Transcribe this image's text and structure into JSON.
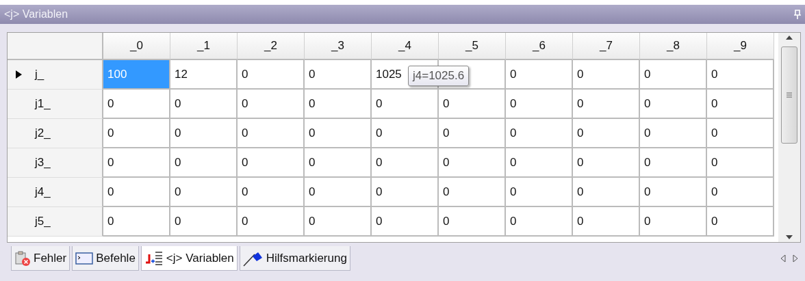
{
  "panel": {
    "title": "<j> Variablen"
  },
  "table": {
    "columns": [
      "_0",
      "_1",
      "_2",
      "_3",
      "_4",
      "_5",
      "_6",
      "_7",
      "_8",
      "_9"
    ],
    "rows": [
      {
        "name": "j_",
        "current": true,
        "cells": [
          {
            "value": "100",
            "selected": true
          },
          {
            "value": "12",
            "selected": false
          },
          {
            "value": "0",
            "selected": false
          },
          {
            "value": "0",
            "selected": false
          },
          {
            "value": "1025",
            "selected": false
          },
          {
            "selected": false
          },
          {
            "value": "0",
            "selected": false
          },
          {
            "value": "0",
            "selected": false
          },
          {
            "value": "0",
            "selected": false
          },
          {
            "value": "0",
            "selected": false
          }
        ]
      },
      {
        "name": "j1_",
        "current": false,
        "cells": [
          {
            "value": "0",
            "selected": false
          },
          {
            "value": "0",
            "selected": false
          },
          {
            "value": "0",
            "selected": false
          },
          {
            "value": "0",
            "selected": false
          },
          {
            "value": "0",
            "selected": false
          },
          {
            "value": "0",
            "selected": false
          },
          {
            "value": "0",
            "selected": false
          },
          {
            "value": "0",
            "selected": false
          },
          {
            "value": "0",
            "selected": false
          },
          {
            "value": "0",
            "selected": false
          }
        ]
      },
      {
        "name": "j2_",
        "current": false,
        "cells": [
          {
            "value": "0",
            "selected": false
          },
          {
            "value": "0",
            "selected": false
          },
          {
            "value": "0",
            "selected": false
          },
          {
            "value": "0",
            "selected": false
          },
          {
            "value": "0",
            "selected": false
          },
          {
            "value": "0",
            "selected": false
          },
          {
            "value": "0",
            "selected": false
          },
          {
            "value": "0",
            "selected": false
          },
          {
            "value": "0",
            "selected": false
          },
          {
            "value": "0",
            "selected": false
          }
        ]
      },
      {
        "name": "j3_",
        "current": false,
        "cells": [
          {
            "value": "0",
            "selected": false
          },
          {
            "value": "0",
            "selected": false
          },
          {
            "value": "0",
            "selected": false
          },
          {
            "value": "0",
            "selected": false
          },
          {
            "value": "0",
            "selected": false
          },
          {
            "value": "0",
            "selected": false
          },
          {
            "value": "0",
            "selected": false
          },
          {
            "value": "0",
            "selected": false
          },
          {
            "value": "0",
            "selected": false
          },
          {
            "value": "0",
            "selected": false
          }
        ]
      },
      {
        "name": "j4_",
        "current": false,
        "cells": [
          {
            "value": "0",
            "selected": false
          },
          {
            "value": "0",
            "selected": false
          },
          {
            "value": "0",
            "selected": false
          },
          {
            "value": "0",
            "selected": false
          },
          {
            "value": "0",
            "selected": false
          },
          {
            "value": "0",
            "selected": false
          },
          {
            "value": "0",
            "selected": false
          },
          {
            "value": "0",
            "selected": false
          },
          {
            "value": "0",
            "selected": false
          },
          {
            "value": "0",
            "selected": false
          }
        ]
      },
      {
        "name": "j5_",
        "current": false,
        "cells": [
          {
            "value": "0",
            "selected": false
          },
          {
            "value": "0",
            "selected": false
          },
          {
            "value": "0",
            "selected": false
          },
          {
            "value": "0",
            "selected": false
          },
          {
            "value": "0",
            "selected": false
          },
          {
            "value": "0",
            "selected": false
          },
          {
            "value": "0",
            "selected": false
          },
          {
            "value": "0",
            "selected": false
          },
          {
            "value": "0",
            "selected": false
          },
          {
            "value": "0",
            "selected": false
          }
        ]
      }
    ],
    "tooltip": {
      "text": "j4=1025.6"
    }
  },
  "tabs": [
    {
      "label": "Fehler",
      "kind": "errors",
      "selected": false
    },
    {
      "label": "Befehle",
      "kind": "commands",
      "selected": false
    },
    {
      "label": "<j> Variablen",
      "kind": "variables",
      "selected": true
    },
    {
      "label": "Hilfsmarkierung",
      "kind": "marker",
      "selected": false
    }
  ]
}
